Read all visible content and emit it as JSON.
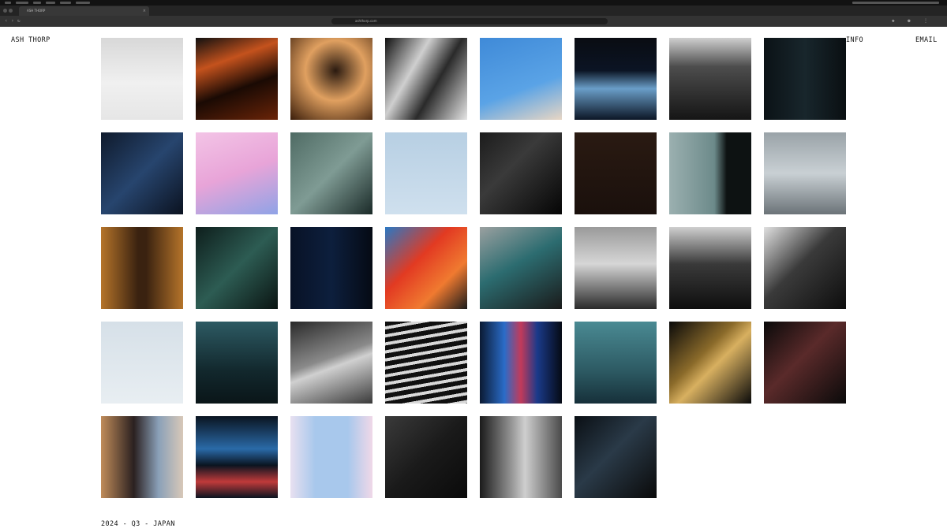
{
  "browser": {
    "tab_title": "ASH THORP",
    "tab_close": "×",
    "address": "ashthorp.com"
  },
  "site": {
    "brand": "ASH THORP",
    "nav_info": "INFO",
    "nav_email": "EMAIL",
    "caption": "2024 - Q3 - JAPAN"
  },
  "gallery": [
    {
      "name": "photo-white-grid-ceiling",
      "bg": "linear-gradient(180deg,#d8d8d8 0%,#f0f0f0 55%,#e6e6e6 100%)"
    },
    {
      "name": "photo-orange-light-streaks",
      "bg": "linear-gradient(160deg,#101010 0%,#c4521d 30%,#1a0a04 60%,#6a2408 100%)"
    },
    {
      "name": "photo-figure-warm-blur",
      "bg": "radial-gradient(circle at 55% 40%,#2a1a10 0%,#e0a060 45%,#3a1d0a 100%)"
    },
    {
      "name": "photo-bw-abstract-lines",
      "bg": "linear-gradient(120deg,#101010 0%,#cfcfcf 35%,#2a2a2a 60%,#e6e6e6 100%)"
    },
    {
      "name": "photo-blue-sky-building",
      "bg": "linear-gradient(160deg,#3f8ad8 0%,#5aa3e6 60%,#e8d6c4 100%)"
    },
    {
      "name": "photo-blue-horizon-dark",
      "bg": "linear-gradient(180deg,#0a0c12 0%,#0b1424 40%,#6a9ec8 62%,#0c1626 100%)"
    },
    {
      "name": "photo-dark-window-room",
      "bg": "linear-gradient(180deg,#cfcfcf 0%,#4d4d4d 35%,#151515 100%)"
    },
    {
      "name": "photo-dark-doorway",
      "bg": "linear-gradient(90deg,#0b1216 0%,#18262c 50%,#0a0f12 100%)"
    },
    {
      "name": "photo-navy-corner-shadow",
      "bg": "linear-gradient(135deg,#0f1a2c 0%,#27456e 50%,#0b1220 100%)"
    },
    {
      "name": "photo-pink-building-window",
      "bg": "linear-gradient(160deg,#f3c4e6 0%,#e8a4d8 50%,#8fa3e6 100%)"
    },
    {
      "name": "photo-teal-stairwell",
      "bg": "linear-gradient(135deg,#4f6b64 0%,#7f9b94 50%,#1a2a28 100%)"
    },
    {
      "name": "photo-pale-blue-haze",
      "bg": "linear-gradient(180deg,#b7cfe3 0%,#cfe0ee 100%)"
    },
    {
      "name": "photo-dark-car-detail",
      "bg": "linear-gradient(135deg,#1c1c1c 0%,#3a3a3a 40%,#050505 100%)"
    },
    {
      "name": "photo-dark-brown-texture",
      "bg": "linear-gradient(180deg,#2a1a12 0%,#1a100c 100%)"
    },
    {
      "name": "photo-misty-teal-glass",
      "bg": "linear-gradient(90deg,#9bb0b0 0%,#6c8a8a 55%,#0d1212 70%,#0d1212 100%)"
    },
    {
      "name": "photo-garage-door",
      "bg": "linear-gradient(180deg,#9aa3a8 0%,#c9d0d4 50%,#6b7378 100%)"
    },
    {
      "name": "photo-amber-corridor",
      "bg": "linear-gradient(90deg,#b5742a 0%,#3a2210 45%,#3a2210 55%,#b5742a 100%)"
    },
    {
      "name": "photo-green-hallway",
      "bg": "linear-gradient(135deg,#0e1e1c 0%,#2d5c53 50%,#0a1412 100%)"
    },
    {
      "name": "photo-navy-yellow-lines",
      "bg": "linear-gradient(90deg,#081226 0%,#0d1f3d 50%,#050a14 100%)"
    },
    {
      "name": "photo-red-orange-car",
      "bg": "linear-gradient(135deg,#2a78c4 0%,#e23a22 40%,#f07a30 70%,#1c1c1c 100%)"
    },
    {
      "name": "photo-teal-car-interior",
      "bg": "linear-gradient(150deg,#9aa0a0 0%,#2c6c70 45%,#1a1a1a 100%)"
    },
    {
      "name": "photo-bw-tower-clouds",
      "bg": "linear-gradient(180deg,#9a9a9a 0%,#d6d6d6 45%,#2a2a2a 100%)"
    },
    {
      "name": "photo-bw-dark-doorway",
      "bg": "linear-gradient(180deg,#cfcfcf 0%,#3a3a3a 45%,#0e0e0e 100%)"
    },
    {
      "name": "photo-bw-curved-rails",
      "bg": "linear-gradient(135deg,#e0e0e0 0%,#3a3a3a 45%,#0d0d0d 100%)"
    },
    {
      "name": "photo-snow-footprints",
      "bg": "linear-gradient(180deg,#d6e0e8 0%,#e8eef2 100%)"
    },
    {
      "name": "photo-dark-teal-gradient",
      "bg": "linear-gradient(180deg,#2d5a63 0%,#12282d 60%,#0a1518 100%)"
    },
    {
      "name": "photo-bw-diagonal-road",
      "bg": "linear-gradient(160deg,#2a2a2a 0%,#8a8a8a 45%,#d0d0d0 55%,#3a3a3a 100%)"
    },
    {
      "name": "photo-bw-stair-pattern",
      "bg": "repeating-linear-gradient(170deg,#101010 0px,#101010 6px,#d8d8d8 6px,#d8d8d8 10px)"
    },
    {
      "name": "photo-neon-blue-streaks",
      "bg": "linear-gradient(90deg,#0b1a33 0%,#2a6cc8 30%,#c23a5a 50%,#1a3a8a 70%,#050a14 100%)"
    },
    {
      "name": "photo-teal-fog",
      "bg": "linear-gradient(180deg,#4a8a93 0%,#2d5a63 60%,#16303a 100%)"
    },
    {
      "name": "photo-gold-light-trails",
      "bg": "linear-gradient(135deg,#0a0a0a 0%,#8a6a2a 40%,#d8b060 55%,#0a0a0a 100%)"
    },
    {
      "name": "photo-dark-red-light-trails",
      "bg": "linear-gradient(135deg,#0a0a0a 0%,#5a2a2a 45%,#0a0a0a 100%)"
    },
    {
      "name": "photo-blurred-pedestrians",
      "bg": "linear-gradient(90deg,#c08c5a 0%,#2a2020 40%,#8aa0b8 70%,#d8c8b8 100%)"
    },
    {
      "name": "photo-blue-neon-streaks",
      "bg": "linear-gradient(180deg,#0a1420 0%,#2a6aa8 40%,#0a1420 60%,#c03a3a 80%,#0a1420 100%)"
    },
    {
      "name": "photo-sky-between-buildings",
      "bg": "linear-gradient(90deg,#e8e0f0 0%,#a8c8ec 30%,#a8c8ec 70%,#f0d8e8 100%)"
    },
    {
      "name": "photo-dark-window-frame",
      "bg": "linear-gradient(135deg,#3a3a3a 0%,#1a1a1a 50%,#0a0a0a 100%)"
    },
    {
      "name": "photo-bw-building-corner",
      "bg": "linear-gradient(90deg,#1a1a1a 0%,#9a9a9a 40%,#cfcfcf 55%,#4a4a4a 100%)"
    },
    {
      "name": "photo-dark-glass-shard",
      "bg": "linear-gradient(135deg,#0a0f14 0%,#2a3a48 45%,#0a0a0a 100%)"
    }
  ]
}
